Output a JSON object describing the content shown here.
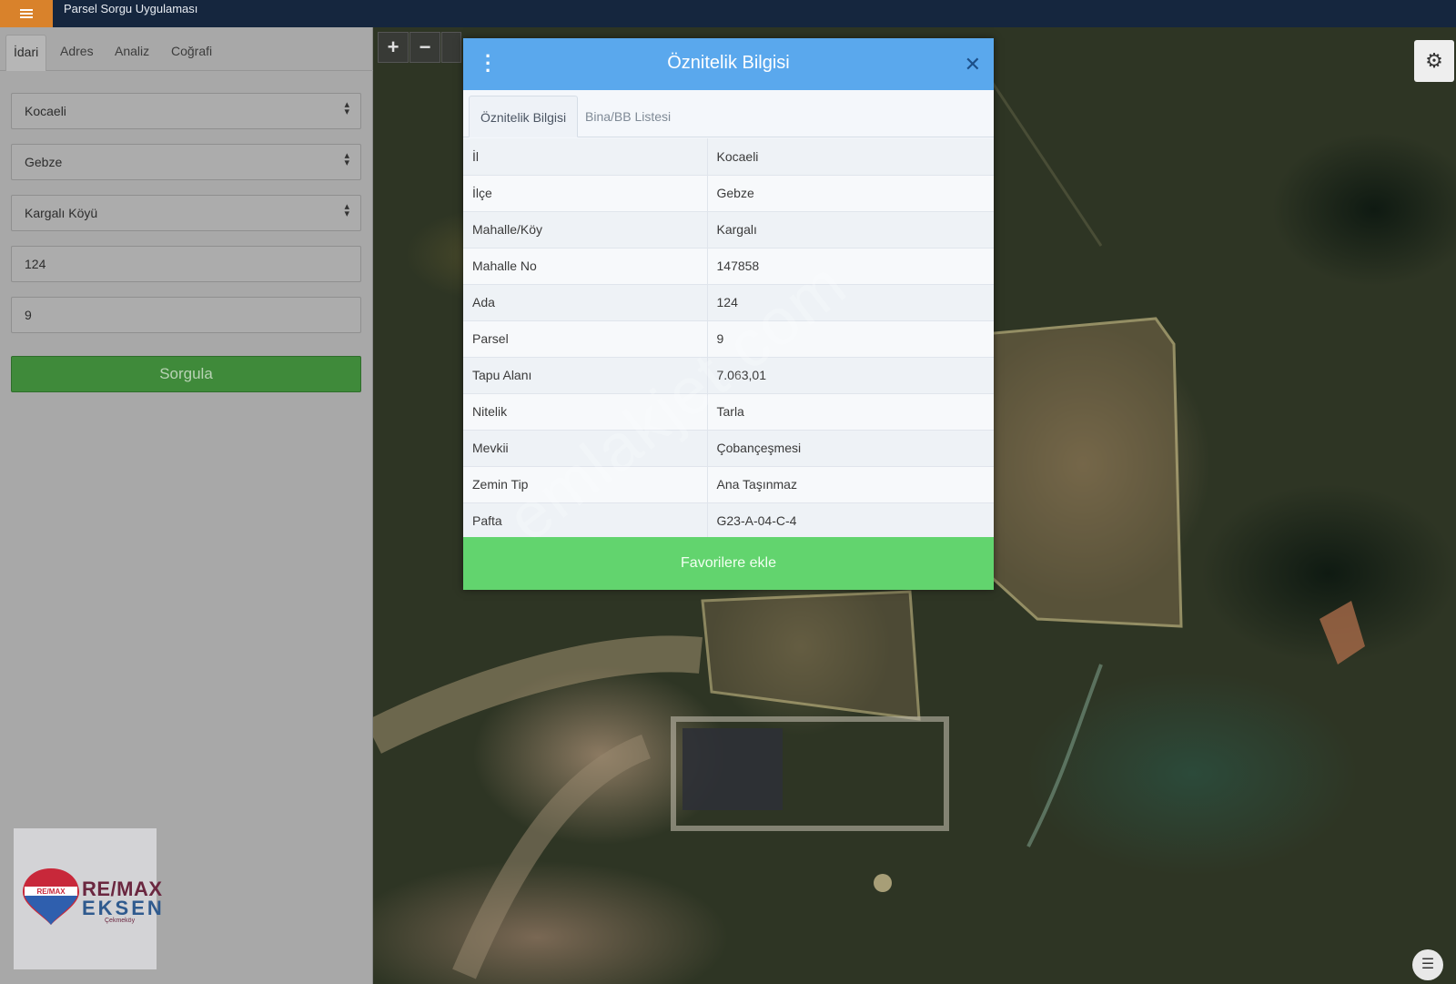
{
  "app": {
    "title": "Parsel Sorgu Uygulaması",
    "menu_icon": "hamburger-icon"
  },
  "left_panel": {
    "tabs": [
      {
        "label": "İdari",
        "active": true
      },
      {
        "label": "Adres",
        "active": false
      },
      {
        "label": "Analiz",
        "active": false
      },
      {
        "label": "Coğrafi",
        "active": false
      }
    ],
    "selects": {
      "il": "Kocaeli",
      "ilce": "Gebze",
      "mahalle": "Kargalı Köyü"
    },
    "inputs": {
      "ada": "124",
      "parsel": "9"
    },
    "submit_label": "Sorgula",
    "logo": {
      "line1": "RE/MAX",
      "line2": "EKSEN",
      "sub": "Çekmeköy",
      "balloon_text": "RE/MAX"
    }
  },
  "map": {
    "zoom_in": "+",
    "zoom_out": "−",
    "settings_icon": "gear-icon",
    "layers_icon": "layers-icon",
    "watermark": "emlakjet.com"
  },
  "dialog": {
    "title": "Öznitelik Bilgisi",
    "kebab_icon": "kebab-menu-icon",
    "close_icon": "close-icon",
    "tabs": [
      {
        "label": "Öznitelik Bilgisi",
        "active": true
      },
      {
        "label": "Bina/BB Listesi",
        "active": false
      }
    ],
    "rows": [
      {
        "key": "İl",
        "value": "Kocaeli"
      },
      {
        "key": "İlçe",
        "value": "Gebze"
      },
      {
        "key": "Mahalle/Köy",
        "value": "Kargalı"
      },
      {
        "key": "Mahalle No",
        "value": "147858"
      },
      {
        "key": "Ada",
        "value": "124"
      },
      {
        "key": "Parsel",
        "value": "9"
      },
      {
        "key": "Tapu Alanı",
        "value": "7.063,01"
      },
      {
        "key": "Nitelik",
        "value": "Tarla"
      },
      {
        "key": "Mevkii",
        "value": "Çobançeşmesi"
      },
      {
        "key": "Zemin Tip",
        "value": "Ana Taşınmaz"
      },
      {
        "key": "Pafta",
        "value": "G23-A-04-C-4"
      }
    ],
    "favorite_label": "Favorilere ekle"
  },
  "colors": {
    "header_blue": "#5aa8ed",
    "fav_green": "#62d46e",
    "submit_green": "#3f8a3a",
    "menu_orange": "#d9822b",
    "topbar": "#15263e"
  }
}
